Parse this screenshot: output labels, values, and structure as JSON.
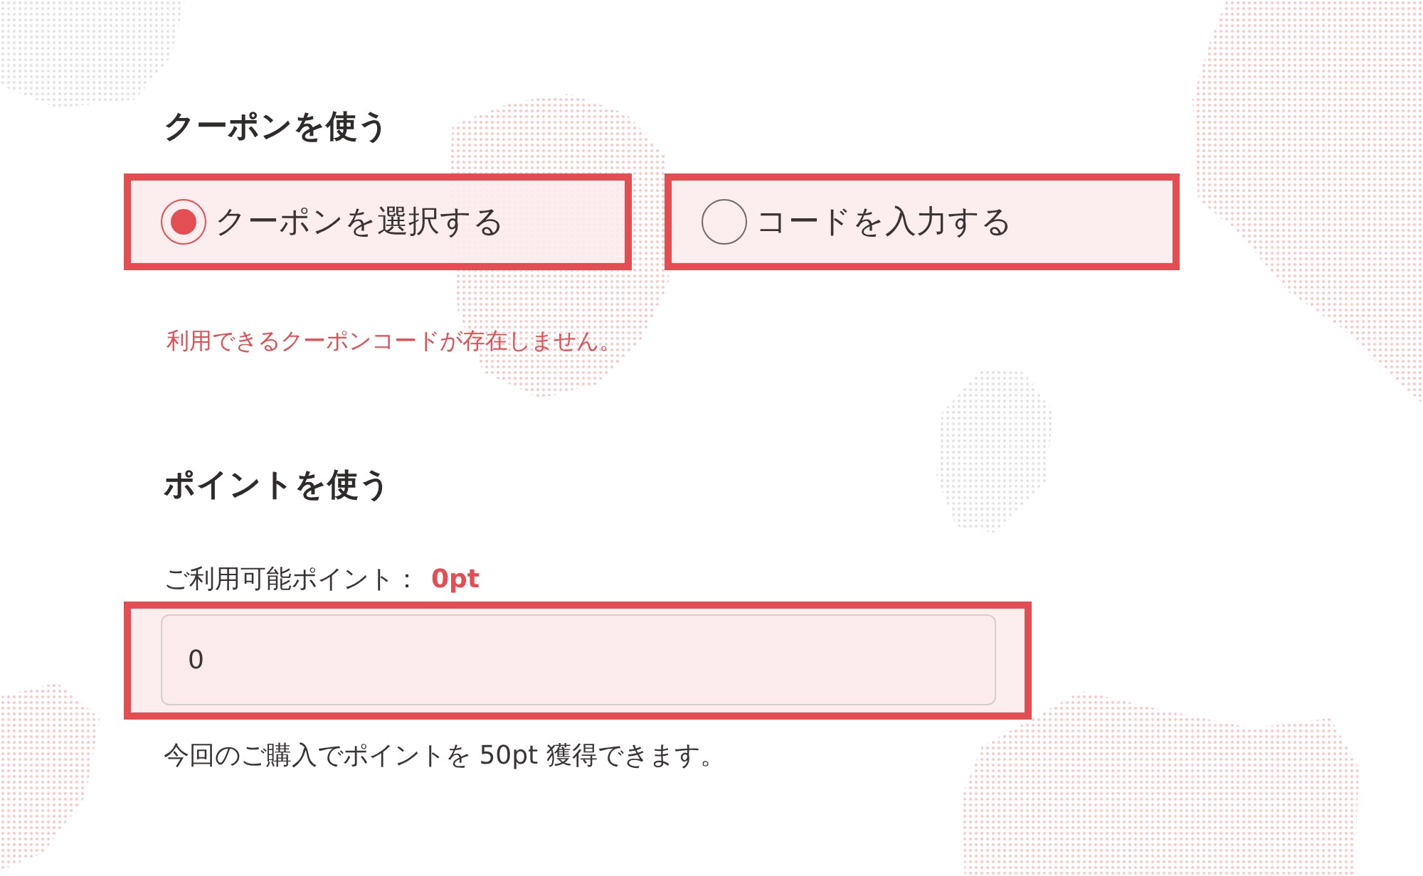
{
  "coupon_section": {
    "title": "クーポンを使う",
    "options": [
      {
        "label": "クーポンを選択する",
        "selected": true,
        "highlighted": true
      },
      {
        "label": "コードを入力する",
        "selected": false,
        "highlighted": true
      }
    ],
    "message": "利用できるクーポンコードが存在しません。"
  },
  "points_section": {
    "title": "ポイントを使う",
    "available_label": "ご利用可能ポイント：",
    "available_value": "0pt",
    "input": {
      "value": "0",
      "highlighted": true
    },
    "note": "今回のご購入でポイントを 50pt 獲得できます。"
  }
}
